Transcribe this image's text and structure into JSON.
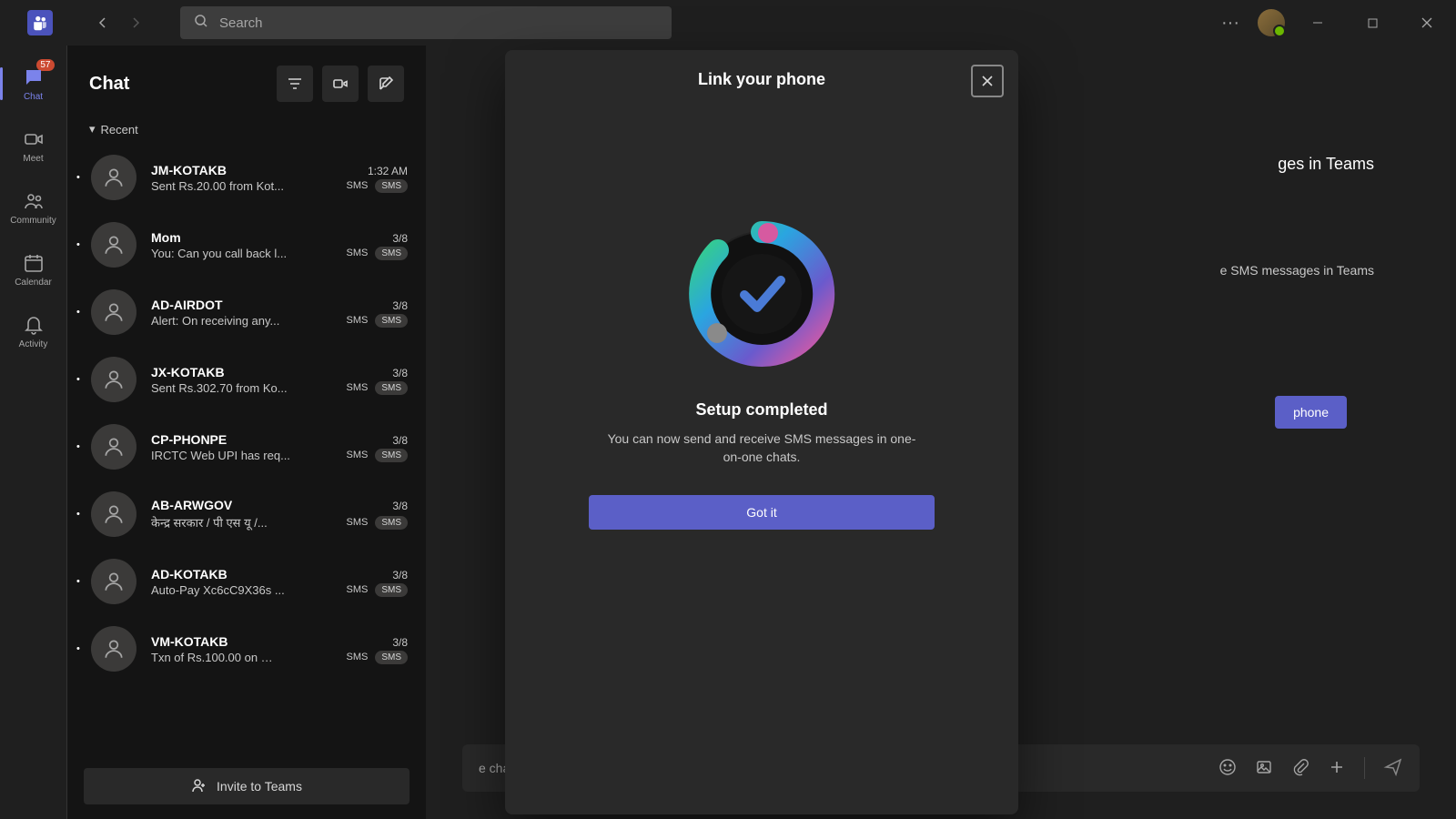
{
  "accent_color": "#5b5fc7",
  "titlebar": {
    "search_placeholder": "Search"
  },
  "rail": {
    "items": [
      {
        "label": "Chat",
        "icon": "chat",
        "badge": "57"
      },
      {
        "label": "Meet",
        "icon": "video"
      },
      {
        "label": "Community",
        "icon": "people"
      },
      {
        "label": "Calendar",
        "icon": "calendar"
      },
      {
        "label": "Activity",
        "icon": "bell"
      }
    ]
  },
  "chat_panel": {
    "title": "Chat",
    "recent_label": "Recent",
    "items": [
      {
        "name": "JM-KOTAKB",
        "time": "1:32 AM",
        "preview": "Sent Rs.20.00 from Kot...",
        "sms": "SMS"
      },
      {
        "name": "Mom",
        "time": "3/8",
        "preview": "You: Can you call back l...",
        "sms": "SMS"
      },
      {
        "name": "AD-AIRDOT",
        "time": "3/8",
        "preview": "Alert: On receiving any...",
        "sms": "SMS"
      },
      {
        "name": "JX-KOTAKB",
        "time": "3/8",
        "preview": "Sent Rs.302.70 from Ko...",
        "sms": "SMS"
      },
      {
        "name": "CP-PHONPE",
        "time": "3/8",
        "preview": "IRCTC Web UPI has req...",
        "sms": "SMS"
      },
      {
        "name": "AB-ARWGOV",
        "time": "3/8",
        "preview": "केन्द्र सरकार / पी एस यू /...",
        "sms": "SMS"
      },
      {
        "name": "AD-KOTAKB",
        "time": "3/8",
        "preview": "Auto-Pay Xc6cC9X36s ...",
        "sms": "SMS"
      },
      {
        "name": "VM-KOTAKB",
        "time": "3/8",
        "preview": "Txn of Rs.100.00 on …",
        "sms": "SMS"
      }
    ],
    "invite_label": "Invite to Teams"
  },
  "content_behind": {
    "headline_fragment": "ges in Teams",
    "sub_fragment": "e SMS messages in Teams",
    "button_fragment": "phone",
    "compose_placeholder_fragment": "e chat."
  },
  "modal": {
    "title": "Link your phone",
    "status": "Setup completed",
    "description": "You can now send and receive SMS messages in one-on-one chats.",
    "got_it": "Got it"
  }
}
